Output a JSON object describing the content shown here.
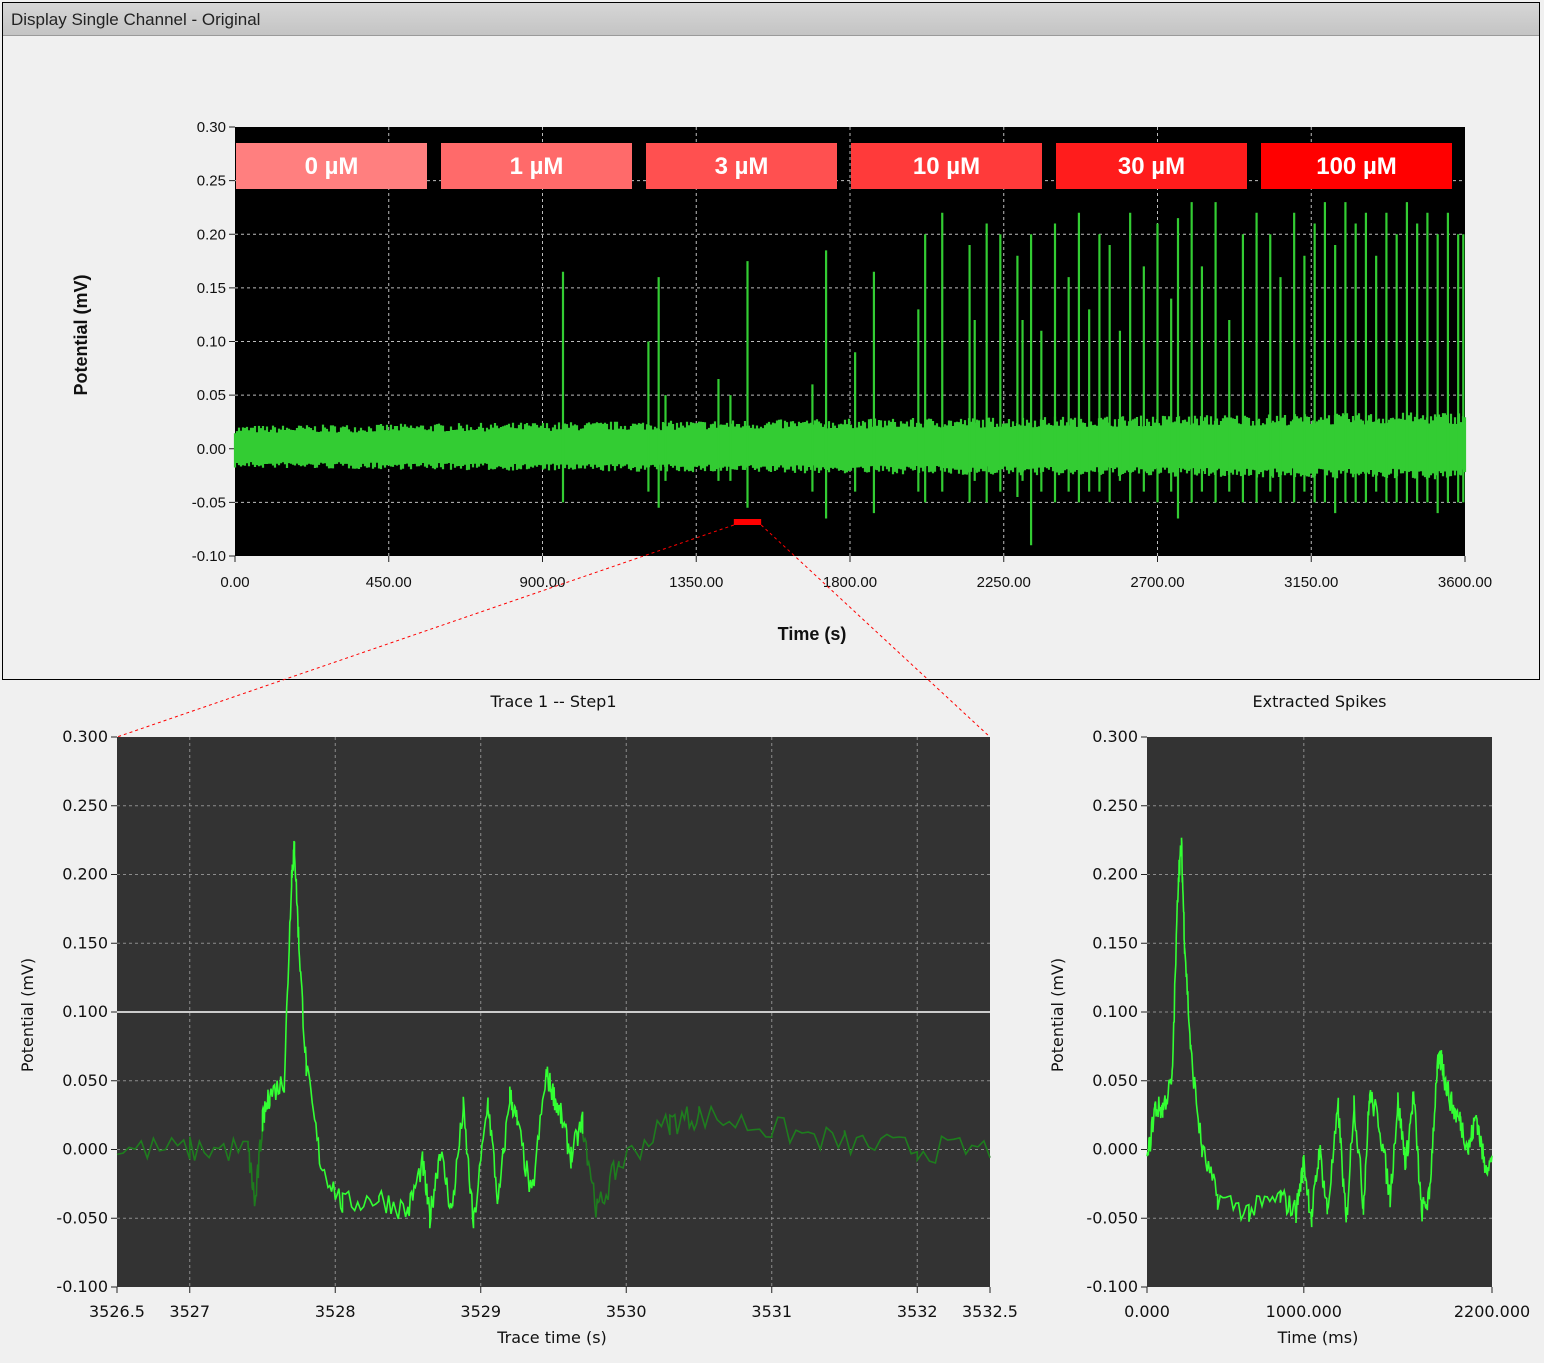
{
  "window": {
    "title": "Display Single Channel - Original"
  },
  "chart_data": [
    {
      "type": "line",
      "title": "",
      "xlabel": "Time (s)",
      "ylabel": "Potential (mV)",
      "xlim": [
        0,
        3600
      ],
      "ylim": [
        -0.1,
        0.3
      ],
      "x_ticks": [
        "0.00",
        "450.00",
        "900.00",
        "1350.00",
        "1800.00",
        "2250.00",
        "2700.00",
        "3150.00",
        "3600.00"
      ],
      "y_ticks": [
        "-0.10",
        "-0.05",
        "0.00",
        "0.05",
        "0.10",
        "0.15",
        "0.20",
        "0.25",
        "0.30"
      ],
      "grid": true,
      "background": "#000000",
      "trace_color": "#33cc33",
      "noise_band": [
        -0.015,
        0.018
      ],
      "concentrations": [
        {
          "label": "0 µM",
          "color": "#ff7f7f"
        },
        {
          "label": "1 µM",
          "color": "#ff6a6a"
        },
        {
          "label": "3 µM",
          "color": "#ff5050"
        },
        {
          "label": "10 µM",
          "color": "#ff3a3a"
        },
        {
          "label": "30 µM",
          "color": "#ff1c1c"
        },
        {
          "label": "100 µM",
          "color": "#ff0000"
        }
      ],
      "spikes": [
        {
          "x": 960,
          "max": 0.165,
          "min": -0.05
        },
        {
          "x": 1240,
          "max": 0.16,
          "min": -0.055
        },
        {
          "x": 1210,
          "max": 0.1,
          "min": -0.04
        },
        {
          "x": 1500,
          "max": 0.175,
          "min": -0.055
        },
        {
          "x": 1260,
          "max": 0.05,
          "min": -0.03
        },
        {
          "x": 1415,
          "max": 0.065,
          "min": -0.03
        },
        {
          "x": 1450,
          "max": 0.05,
          "min": -0.03
        },
        {
          "x": 1730,
          "max": 0.185,
          "min": -0.065
        },
        {
          "x": 1690,
          "max": 0.06,
          "min": -0.04
        },
        {
          "x": 1870,
          "max": 0.165,
          "min": -0.06
        },
        {
          "x": 1815,
          "max": 0.09,
          "min": -0.04
        },
        {
          "x": 2020,
          "max": 0.2,
          "min": -0.05
        },
        {
          "x": 2000,
          "max": 0.13,
          "min": -0.04
        },
        {
          "x": 2070,
          "max": 0.22,
          "min": -0.04
        },
        {
          "x": 2150,
          "max": 0.19,
          "min": -0.05
        },
        {
          "x": 2165,
          "max": 0.12,
          "min": -0.03
        },
        {
          "x": 2200,
          "max": 0.21,
          "min": -0.05
        },
        {
          "x": 2240,
          "max": 0.2,
          "min": -0.04
        },
        {
          "x": 2290,
          "max": 0.18,
          "min": -0.045
        },
        {
          "x": 2305,
          "max": 0.12,
          "min": -0.03
        },
        {
          "x": 2330,
          "max": 0.2,
          "min": -0.09
        },
        {
          "x": 2360,
          "max": 0.11,
          "min": -0.04
        },
        {
          "x": 2400,
          "max": 0.21,
          "min": -0.05
        },
        {
          "x": 2440,
          "max": 0.16,
          "min": -0.04
        },
        {
          "x": 2470,
          "max": 0.22,
          "min": -0.05
        },
        {
          "x": 2500,
          "max": 0.13,
          "min": -0.04
        },
        {
          "x": 2530,
          "max": 0.2,
          "min": -0.04
        },
        {
          "x": 2560,
          "max": 0.19,
          "min": -0.05
        },
        {
          "x": 2590,
          "max": 0.11,
          "min": -0.03
        },
        {
          "x": 2620,
          "max": 0.22,
          "min": -0.05
        },
        {
          "x": 2660,
          "max": 0.17,
          "min": -0.04
        },
        {
          "x": 2700,
          "max": 0.21,
          "min": -0.05
        },
        {
          "x": 2740,
          "max": 0.14,
          "min": -0.04
        },
        {
          "x": 2760,
          "max": 0.215,
          "min": -0.065
        },
        {
          "x": 2800,
          "max": 0.23,
          "min": -0.05
        },
        {
          "x": 2830,
          "max": 0.17,
          "min": -0.04
        },
        {
          "x": 2870,
          "max": 0.23,
          "min": -0.05
        },
        {
          "x": 2910,
          "max": 0.12,
          "min": -0.04
        },
        {
          "x": 2950,
          "max": 0.2,
          "min": -0.05
        },
        {
          "x": 2990,
          "max": 0.22,
          "min": -0.05
        },
        {
          "x": 3030,
          "max": 0.2,
          "min": -0.04
        },
        {
          "x": 3060,
          "max": 0.16,
          "min": -0.05
        },
        {
          "x": 3100,
          "max": 0.22,
          "min": -0.05
        },
        {
          "x": 3130,
          "max": 0.18,
          "min": -0.04
        },
        {
          "x": 3160,
          "max": 0.21,
          "min": -0.05
        },
        {
          "x": 3190,
          "max": 0.23,
          "min": -0.05
        },
        {
          "x": 3220,
          "max": 0.19,
          "min": -0.06
        },
        {
          "x": 3250,
          "max": 0.23,
          "min": -0.05
        },
        {
          "x": 3280,
          "max": 0.21,
          "min": -0.05
        },
        {
          "x": 3310,
          "max": 0.22,
          "min": -0.05
        },
        {
          "x": 3340,
          "max": 0.18,
          "min": -0.04
        },
        {
          "x": 3370,
          "max": 0.22,
          "min": -0.05
        },
        {
          "x": 3400,
          "max": 0.2,
          "min": -0.05
        },
        {
          "x": 3430,
          "max": 0.23,
          "min": -0.05
        },
        {
          "x": 3460,
          "max": 0.21,
          "min": -0.05
        },
        {
          "x": 3490,
          "max": 0.22,
          "min": -0.05
        },
        {
          "x": 3520,
          "max": 0.2,
          "min": -0.06
        },
        {
          "x": 3550,
          "max": 0.22,
          "min": -0.05
        },
        {
          "x": 3580,
          "max": 0.2,
          "min": -0.05
        },
        {
          "x": 3595,
          "max": 0.2,
          "min": -0.05
        }
      ],
      "zoom_range": [
        1460,
        1540
      ],
      "zoom_marker_color": "#ff0000"
    },
    {
      "type": "line",
      "title": "Trace 1 -- Step1",
      "xlabel": "Trace time (s)",
      "ylabel": "Potential (mV)",
      "xlim": [
        3526.5,
        3532.5
      ],
      "ylim": [
        -0.1,
        0.3
      ],
      "x_ticks": [
        "3526.5",
        "3527",
        "3528",
        "3529",
        "3530",
        "3531",
        "3532",
        "3532.5"
      ],
      "y_ticks": [
        "-0.100",
        "-0.050",
        "0.000",
        "0.050",
        "0.100",
        "0.150",
        "0.200",
        "0.250",
        "0.300"
      ],
      "grid": true,
      "background": "#333333",
      "threshold": 0.1,
      "highlight_color": "#33ff33",
      "dim_color": "#1e7d1e",
      "x": [
        3526.5,
        3527.0,
        3527.4,
        3527.45,
        3527.5,
        3527.55,
        3527.65,
        3527.7,
        3527.72,
        3527.75,
        3527.8,
        3527.9,
        3528.05,
        3528.3,
        3528.5,
        3528.6,
        3528.65,
        3528.72,
        3528.8,
        3528.88,
        3528.95,
        3529.05,
        3529.12,
        3529.2,
        3529.25,
        3529.35,
        3529.45,
        3529.5,
        3529.55,
        3529.62,
        3529.7,
        3529.8,
        3529.95,
        3530.3,
        3530.5,
        3531.0,
        3531.5,
        3532.0,
        3532.5
      ],
      "y": [
        0.0,
        0.0,
        0.0,
        -0.04,
        0.02,
        0.04,
        0.05,
        0.2,
        0.22,
        0.15,
        0.06,
        -0.01,
        -0.04,
        -0.035,
        -0.045,
        -0.01,
        -0.05,
        0.0,
        -0.045,
        0.03,
        -0.055,
        0.035,
        -0.04,
        0.04,
        0.02,
        -0.035,
        0.055,
        0.04,
        0.025,
        -0.005,
        0.02,
        -0.045,
        -0.01,
        0.02,
        0.025,
        0.015,
        0.005,
        0.0,
        0.0
      ],
      "highlight_range": [
        3527.5,
        3529.7
      ]
    },
    {
      "type": "line",
      "title": "Extracted Spikes",
      "xlabel": "Time (ms)",
      "ylabel": "Potential (mV)",
      "xlim": [
        0,
        2200
      ],
      "ylim": [
        -0.1,
        0.3
      ],
      "x_ticks": [
        "0.000",
        "1000.000",
        "2200.000"
      ],
      "y_ticks": [
        "-0.100",
        "-0.050",
        "0.000",
        "0.050",
        "0.100",
        "0.150",
        "0.200",
        "0.250",
        "0.300"
      ],
      "grid": true,
      "background": "#333333",
      "trace_color": "#33ff33",
      "x": [
        0,
        50,
        100,
        160,
        200,
        220,
        240,
        280,
        350,
        450,
        650,
        850,
        950,
        1000,
        1050,
        1100,
        1150,
        1220,
        1270,
        1320,
        1380,
        1420,
        1480,
        1550,
        1600,
        1650,
        1700,
        1750,
        1800,
        1850,
        1880,
        1900,
        1950,
        2000,
        2050,
        2100,
        2150,
        2200
      ],
      "y": [
        -0.01,
        0.03,
        0.03,
        0.05,
        0.2,
        0.22,
        0.15,
        0.07,
        0.0,
        -0.035,
        -0.045,
        -0.035,
        -0.045,
        -0.01,
        -0.05,
        0.0,
        -0.045,
        0.03,
        -0.055,
        0.035,
        -0.04,
        0.04,
        0.02,
        -0.035,
        0.035,
        -0.01,
        0.04,
        -0.045,
        -0.035,
        0.06,
        0.065,
        0.05,
        0.03,
        0.02,
        0.0,
        0.025,
        -0.01,
        -0.01
      ]
    }
  ]
}
